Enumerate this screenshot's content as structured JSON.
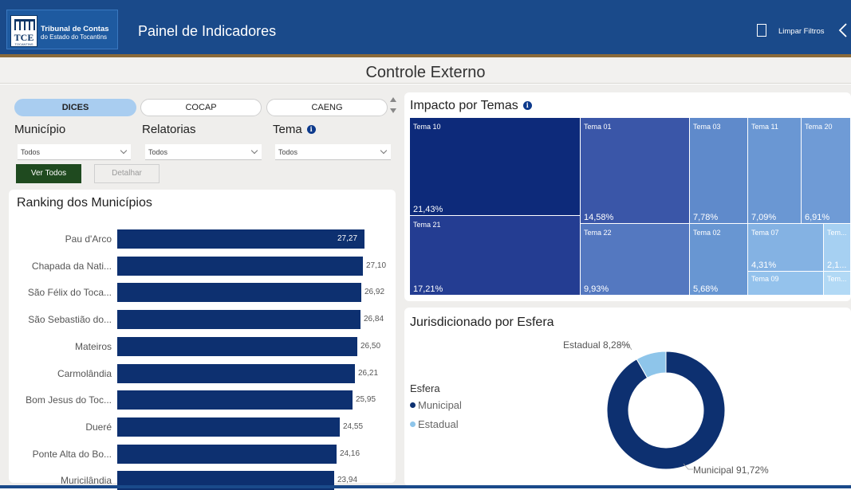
{
  "header": {
    "org_name_line1": "Tribunal de Contas",
    "org_name_line2": "do Estado do Tocantins",
    "logo_text": "TCE",
    "logo_subtext": "TOCANTINS",
    "app_title": "Painel de Indicadores",
    "clear_filters_label": "Limpar Filtros",
    "bookmark_icon": "bookmark-icon",
    "back_icon": "chevron-left-icon"
  },
  "section_title": "Controle Externo",
  "tabs": [
    {
      "label": "DICES",
      "selected": true
    },
    {
      "label": "COCAP",
      "selected": false
    },
    {
      "label": "CAENG",
      "selected": false
    }
  ],
  "filters": [
    {
      "label": "Município",
      "value": "Todos"
    },
    {
      "label": "Relatorias",
      "value": "Todos"
    },
    {
      "label": "Tema",
      "value": "Todos",
      "info_icon": "info-icon"
    }
  ],
  "buttons": {
    "ver_todos": "Ver Todos",
    "detalhar": "Detalhar"
  },
  "ranking": {
    "title": "Ranking dos Municípios",
    "bar_color": "#0d3070",
    "items": [
      {
        "label": "Pau d'Arco",
        "value": 27.27,
        "value_label": "27,27"
      },
      {
        "label": "Chapada da Nati...",
        "value": 27.1,
        "value_label": "27,10"
      },
      {
        "label": "São Félix do Toca...",
        "value": 26.92,
        "value_label": "26,92"
      },
      {
        "label": "São Sebastião do...",
        "value": 26.84,
        "value_label": "26,84"
      },
      {
        "label": "Mateiros",
        "value": 26.5,
        "value_label": "26,50"
      },
      {
        "label": "Carmolândia",
        "value": 26.21,
        "value_label": "26,21"
      },
      {
        "label": "Bom Jesus do Toc...",
        "value": 25.95,
        "value_label": "25,95"
      },
      {
        "label": "Dueré",
        "value": 24.55,
        "value_label": "24,55"
      },
      {
        "label": "Ponte Alta do Bo...",
        "value": 24.16,
        "value_label": "24,16"
      },
      {
        "label": "Muricilândia",
        "value": 23.94,
        "value_label": "23,94"
      }
    ]
  },
  "impacto": {
    "title": "Impacto por Temas",
    "info_icon": "info-icon",
    "tiles": [
      {
        "name": "Tema 10",
        "percent": "21,43%",
        "color": "#0d2a7a"
      },
      {
        "name": "Tema 21",
        "percent": "17,21%",
        "color": "#243d92"
      },
      {
        "name": "Tema 01",
        "percent": "14,58%",
        "color": "#3a56a8"
      },
      {
        "name": "Tema 22",
        "percent": "9,93%",
        "color": "#5478c0"
      },
      {
        "name": "Tema 03",
        "percent": "7,78%",
        "color": "#5f8acb"
      },
      {
        "name": "Tema 02",
        "percent": "5,68%",
        "color": "#6896d2"
      },
      {
        "name": "Tema 11",
        "percent": "7,09%",
        "color": "#6a97d3"
      },
      {
        "name": "Tema 20",
        "percent": "6,91%",
        "color": "#6f9bd6"
      },
      {
        "name": "Tema 07",
        "percent": "4,31%",
        "color": "#84b2e3"
      },
      {
        "name": "Tema 09",
        "percent": "",
        "color": "#94c2ec"
      },
      {
        "name": "Tem...",
        "percent": "2,1...",
        "color": "#a6d0f2"
      },
      {
        "name": "Tem...",
        "percent": "",
        "color": "#b2d9f5"
      }
    ]
  },
  "esfera": {
    "title": "Jurisdicionado por Esfera",
    "legend_title": "Esfera",
    "legend": [
      {
        "label": "Municipal",
        "color": "#0d3070"
      },
      {
        "label": "Estadual",
        "color": "#8ec5ea"
      }
    ],
    "labels": {
      "municipal": "Municipal 91,72%",
      "estadual": "Estadual 8,28%"
    }
  },
  "chart_data": [
    {
      "type": "bar",
      "title": "Ranking dos Municípios",
      "categories": [
        "Pau d'Arco",
        "Chapada da Nati...",
        "São Félix do Toca...",
        "São Sebastião do...",
        "Mateiros",
        "Carmolândia",
        "Bom Jesus do Toc...",
        "Dueré",
        "Ponte Alta do Bo...",
        "Muricilândia"
      ],
      "values": [
        27.27,
        27.1,
        26.92,
        26.84,
        26.5,
        26.21,
        25.95,
        24.55,
        24.16,
        23.94
      ]
    },
    {
      "type": "treemap",
      "title": "Impacto por Temas",
      "categories": [
        "Tema 10",
        "Tema 21",
        "Tema 01",
        "Tema 22",
        "Tema 03",
        "Tema 02",
        "Tema 11",
        "Tema 20",
        "Tema 07"
      ],
      "values": [
        21.43,
        17.21,
        14.58,
        9.93,
        7.78,
        5.68,
        7.09,
        6.91,
        4.31
      ]
    },
    {
      "type": "pie",
      "title": "Jurisdicionado por Esfera",
      "categories": [
        "Municipal",
        "Estadual"
      ],
      "values": [
        91.72,
        8.28
      ]
    }
  ]
}
